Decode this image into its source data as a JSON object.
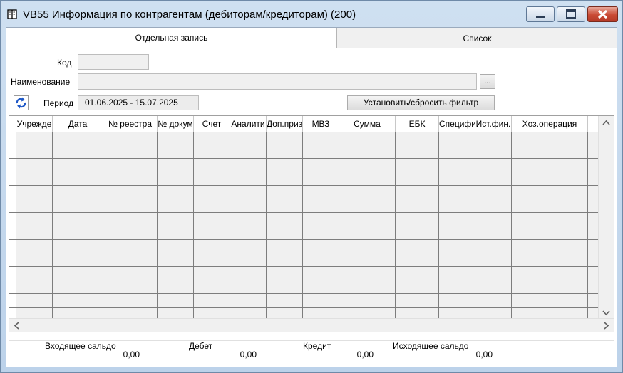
{
  "window": {
    "title": "VB55 Информация по контрагентам (дебиторам/кредиторам) (200)",
    "icon": "book-icon",
    "controls": [
      "minimize-icon",
      "maximize-icon",
      "close-icon"
    ]
  },
  "tabs": [
    {
      "label": "Отдельная запись",
      "active": true
    },
    {
      "label": "Список",
      "active": false
    }
  ],
  "form": {
    "code_label": "Код",
    "code_value": "",
    "name_label": "Наименование",
    "name_value": "",
    "browse_label": "...",
    "period_label": "Период",
    "period_value": "01.06.2025  -  15.07.2025",
    "filter_button": "Установить/сбросить фильтр",
    "refresh_icon": "refresh-icon"
  },
  "grid": {
    "columns": [
      "Учрежде",
      "Дата",
      "№ реестра",
      "№ докум",
      "Счет",
      "Аналити",
      "Доп.приз",
      "МВЗ",
      "Сумма",
      "ЕБК",
      "Специфи",
      "Ист.фин.",
      "Хоз.операция",
      ""
    ],
    "row_count": 14
  },
  "totals": {
    "labels": [
      "Входящее сальдо",
      "Дебет",
      "Кредит",
      "Исходящее сальдо"
    ],
    "values": [
      "0,00",
      "0,00",
      "0,00",
      "0,00"
    ]
  },
  "colors": {
    "close_button": "#c94a35",
    "grid_line": "#7d7d7d",
    "cell_bg": "#f0f0f0"
  }
}
